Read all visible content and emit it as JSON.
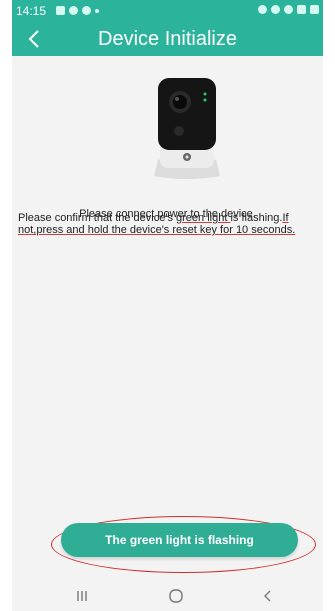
{
  "status_bar": {
    "time": "14:15"
  },
  "header": {
    "title": "Device Initialize",
    "back_icon": "chevron-left-icon"
  },
  "main": {
    "image": "camera-icon",
    "connect_text": "Please connect power to the device.",
    "confirm_text": {
      "part1": "Please confirm that the device's ",
      "part2": "green light ",
      "part3": "is flashing.",
      "part4": "If not,press and hold the device's reset key for 10 seconds."
    }
  },
  "action": {
    "button_label": "The green light is flashing"
  },
  "nav_bar": {
    "recent_icon": "recent-apps-icon",
    "home_icon": "home-icon",
    "back_icon": "back-icon"
  },
  "colors": {
    "header": "#2bb39c",
    "button": "#2fae95",
    "annotation": "#d32f2f",
    "background": "#f3f3f3"
  }
}
